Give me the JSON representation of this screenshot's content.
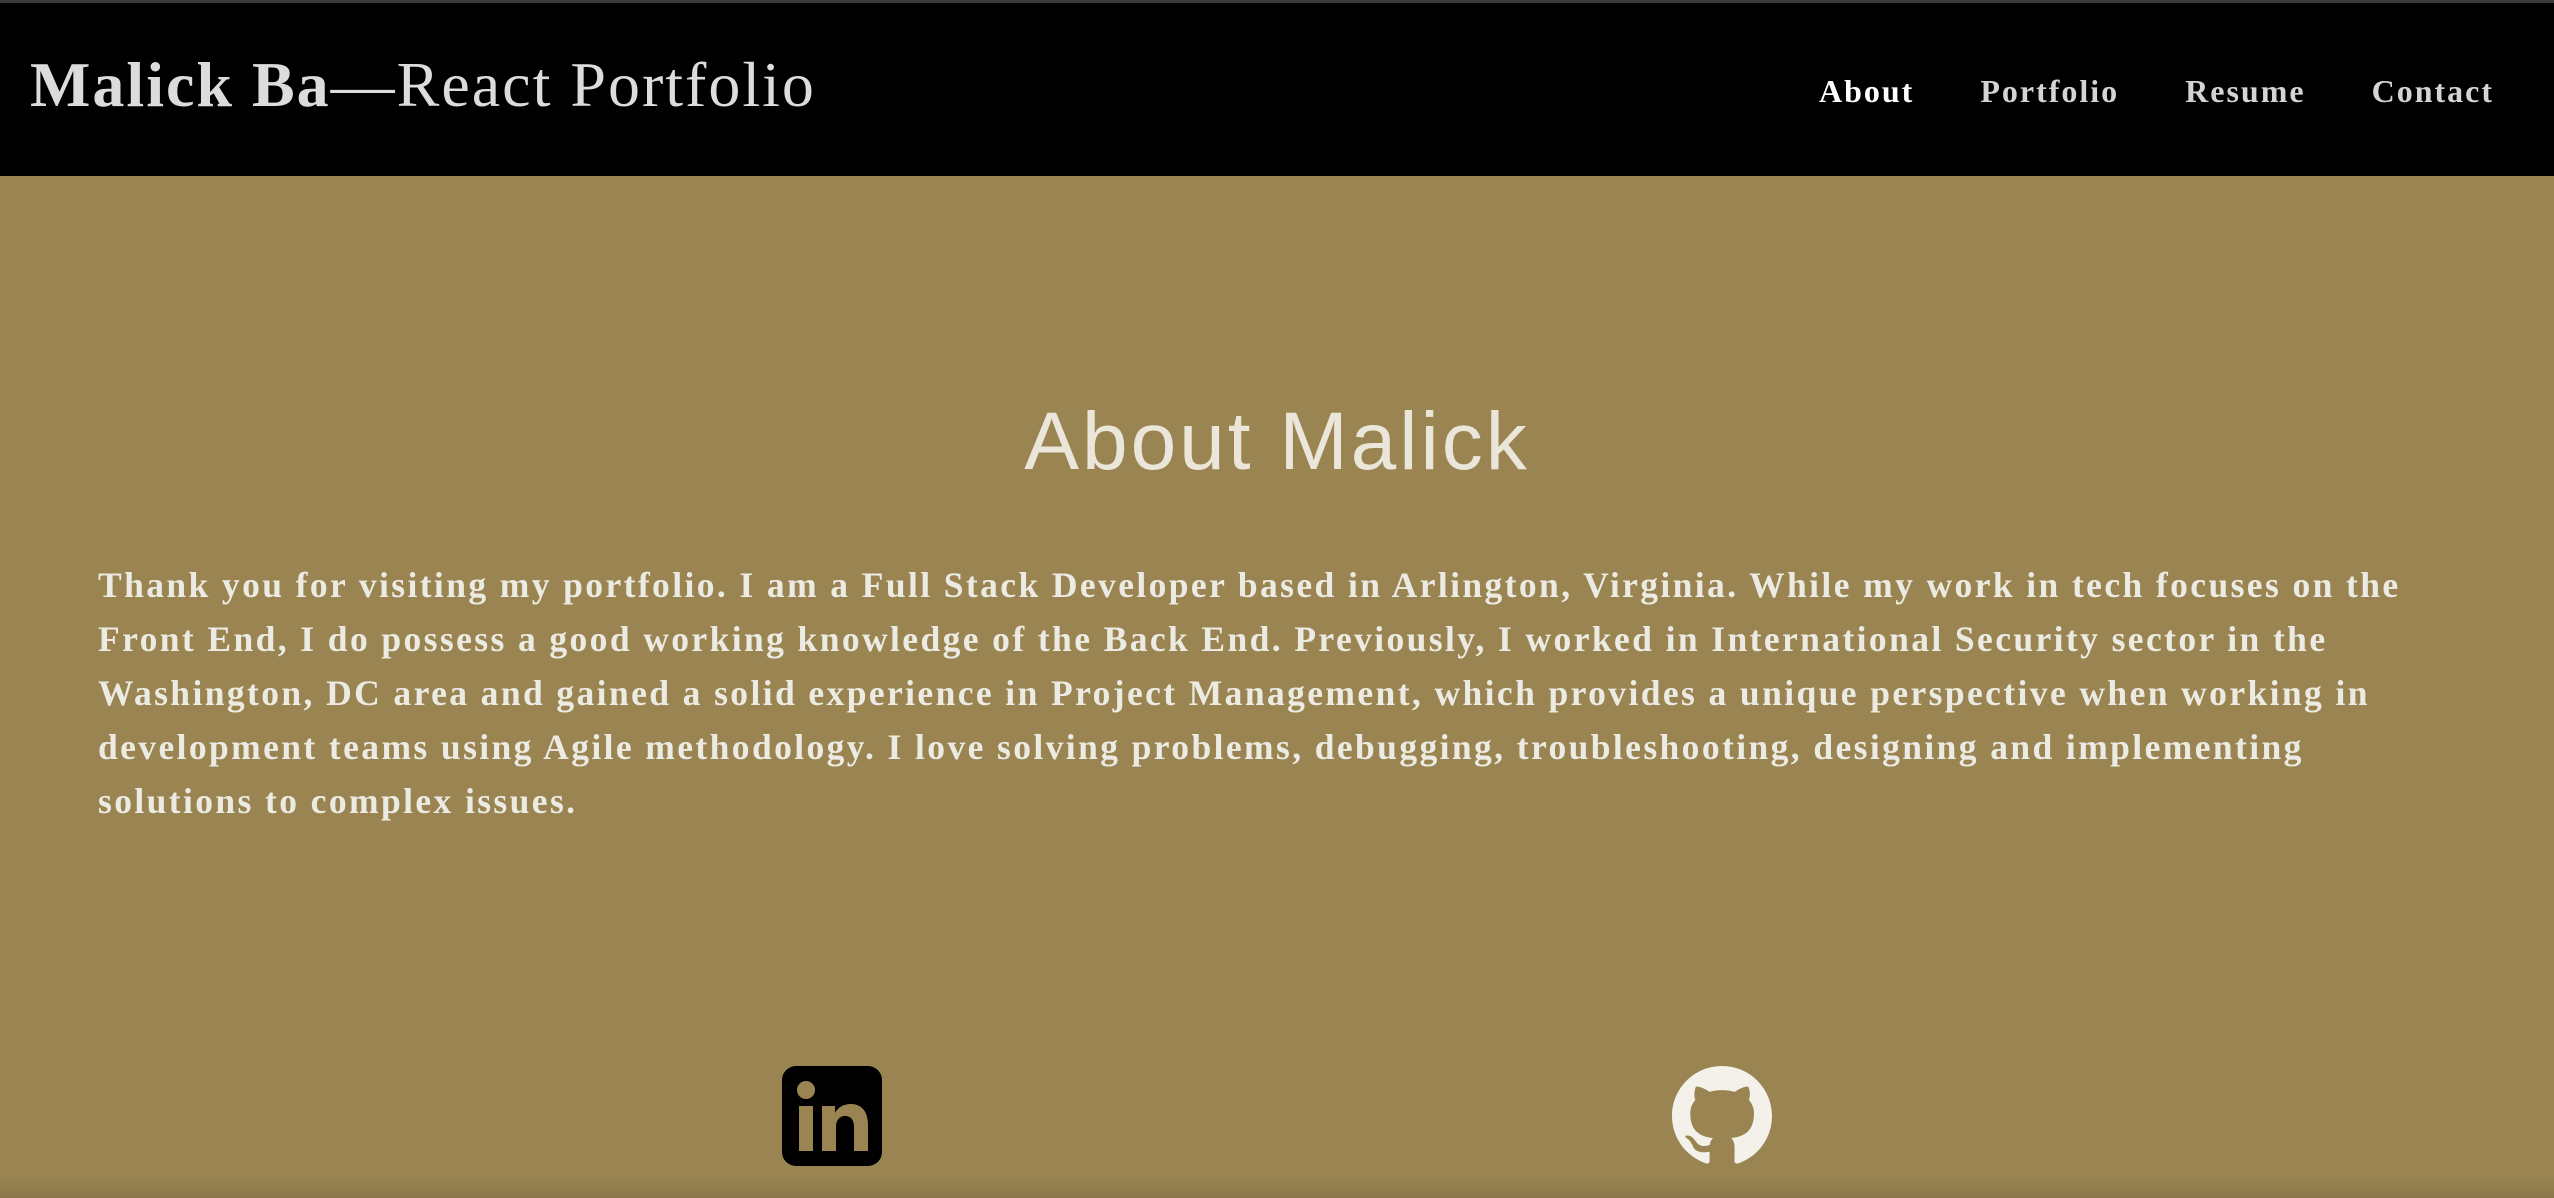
{
  "header": {
    "brand_name": "Malick Ba",
    "brand_rest": "—React Portfolio",
    "nav": [
      {
        "label": "About",
        "active": true
      },
      {
        "label": "Portfolio",
        "active": false
      },
      {
        "label": "Resume",
        "active": false
      },
      {
        "label": "Contact",
        "active": false
      }
    ]
  },
  "about": {
    "title": "About Malick",
    "text": "Thank you for visiting my portfolio. I am a Full Stack Developer based in Arlington, Virginia. While my work in tech focuses on the Front End, I do possess a good working knowledge of the Back End. Previously, I worked in International Security sector in the Washington, DC area and gained a solid experience in Project Management, which provides a unique perspective when working in development teams using Agile methodology. I love solving problems, debugging, troubleshooting, designing and implementing solutions to complex issues."
  },
  "social": [
    {
      "icon": "linkedin-icon"
    },
    {
      "icon": "github-icon"
    }
  ],
  "colors": {
    "header_bg": "#000000",
    "page_bg": "#9a8552",
    "text": "#ecebe3"
  }
}
